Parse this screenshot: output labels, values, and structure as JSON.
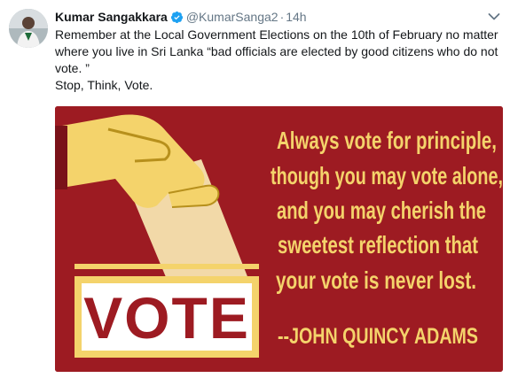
{
  "tweet": {
    "author_name": "Kumar Sangakkara",
    "handle": "@KumarSanga2",
    "separator": "·",
    "time": "14h",
    "body_line1": "Remember at the Local Government Elections on the 10th of February no matter where you live in Sri Lanka “bad officials are elected by good citizens who do not vote. ”",
    "body_line2": "Stop, Think, Vote."
  },
  "media": {
    "vote_label": "VOTE",
    "quote_lines": [
      "Always vote for principle,",
      "though you may vote alone,",
      "and you may cherish the",
      "sweetest reflection that",
      "your vote is never lost."
    ],
    "attribution": "--JOHN QUINCY ADAMS"
  },
  "icons": {
    "verified": "verified-badge-icon",
    "caret": "chevron-down-icon",
    "hand": "hand-holding-ballot-icon"
  },
  "colors": {
    "background": "#9d1b22",
    "text_yellow": "#f4d36b",
    "verified_blue": "#1da1f2",
    "muted_grey": "#657786"
  }
}
